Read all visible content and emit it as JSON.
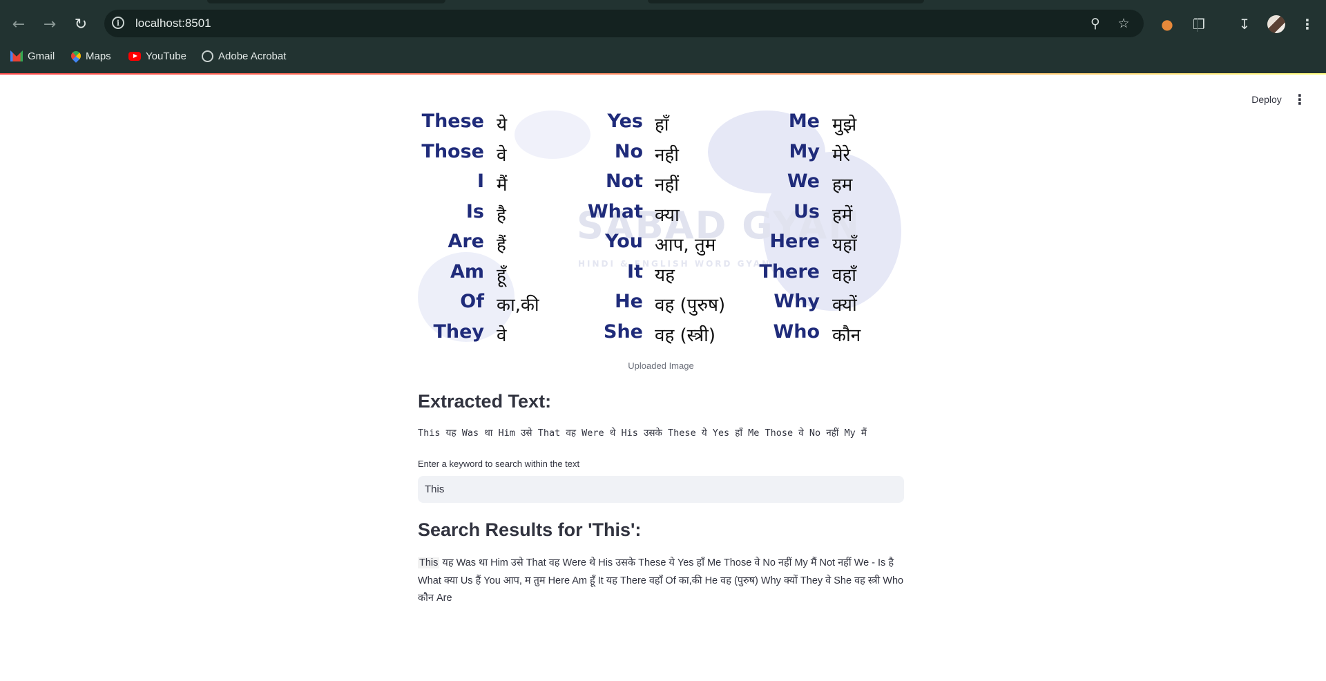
{
  "browser": {
    "url": "localhost:8501",
    "bookmarks": [
      {
        "label": "Gmail",
        "icon": "gmail-icon"
      },
      {
        "label": "Maps",
        "icon": "maps-icon"
      },
      {
        "label": "YouTube",
        "icon": "youtube-icon"
      },
      {
        "label": "Adobe Acrobat",
        "icon": "globe-icon"
      }
    ]
  },
  "header": {
    "deploy_label": "Deploy",
    "menu_icon": "kebab-menu-icon"
  },
  "uploaded_image": {
    "watermark": "SABAD GYAN",
    "watermark_sub": "HINDI & ENGLISH WORD GYAN",
    "caption": "Uploaded Image",
    "columns": [
      {
        "words": [
          {
            "en": "These",
            "hi": "ये"
          },
          {
            "en": "Those",
            "hi": "वे"
          },
          {
            "en": "I",
            "hi": "मैं"
          },
          {
            "en": "Is",
            "hi": "है"
          },
          {
            "en": "Are",
            "hi": "हैं"
          },
          {
            "en": "Am",
            "hi": "हूँ"
          },
          {
            "en": "Of",
            "hi": "का,की"
          },
          {
            "en": "They",
            "hi": "वे"
          }
        ]
      },
      {
        "words": [
          {
            "en": "Yes",
            "hi": "हाँ"
          },
          {
            "en": "No",
            "hi": "नही"
          },
          {
            "en": "Not",
            "hi": "नहीं"
          },
          {
            "en": "What",
            "hi": "क्या"
          },
          {
            "en": "You",
            "hi": "आप, तुम"
          },
          {
            "en": "It",
            "hi": "यह"
          },
          {
            "en": "He",
            "hi": "वह (पुरुष)"
          },
          {
            "en": "She",
            "hi": "वह (स्त्री)"
          }
        ]
      },
      {
        "words": [
          {
            "en": "Me",
            "hi": "मुझे"
          },
          {
            "en": "My",
            "hi": "मेरे"
          },
          {
            "en": "We",
            "hi": "हम"
          },
          {
            "en": "Us",
            "hi": "हमें"
          },
          {
            "en": "Here",
            "hi": "यहाँ"
          },
          {
            "en": "There",
            "hi": "वहाँ"
          },
          {
            "en": "Why",
            "hi": "क्यों"
          },
          {
            "en": "Who",
            "hi": "कौन"
          }
        ]
      }
    ]
  },
  "extracted": {
    "heading": "Extracted Text:",
    "text": "This यह Was था Him उसे That वह Were थे His उसके These ये Yes हाँ Me Those वे No  नहीं My मैं"
  },
  "search": {
    "label": "Enter a keyword to search within the text",
    "value": "This",
    "heading": "Search Results for 'This':",
    "match": "This",
    "rest": " यह Was था Him उसे That वह Were थे His उसके These ये Yes हाँ Me Those वे No नहीं My मैं Not नहीं We - Is है What क्या Us हैं You आप, म तुम Here Am हूँ It यह There वहाँ Of का,की He वह (पुरुष) Why क्यों They वे She वह स्त्री Who कौन Are"
  }
}
